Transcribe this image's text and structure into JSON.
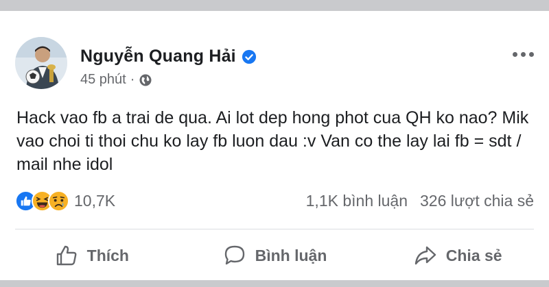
{
  "post": {
    "author": "Nguyễn Quang Hải",
    "time": "45 phút",
    "meta_separator": "·",
    "text": "Hack vao fb a trai de qua. Ai lot dep hong phot cua QH ko nao? Mik vao choi ti thoi chu ko lay fb luon dau :v Van co the lay lai fb = sdt / mail nhe idol",
    "reactions_count": "10,7K",
    "comments_count": "1,1K bình luận",
    "shares_count": "326 lượt chia sẻ"
  },
  "actions": {
    "like_label": "Thích",
    "comment_label": "Bình luận",
    "share_label": "Chia sẻ"
  },
  "icons": {
    "verified": "verified-badge-icon",
    "privacy": "globe-icon",
    "menu": "more-horizontal-icon",
    "reactions": [
      "like-reaction-icon",
      "haha-reaction-icon",
      "sad-reaction-icon"
    ],
    "like": "thumbs-up-icon",
    "comment": "speech-bubble-icon",
    "share": "share-arrow-icon"
  },
  "colors": {
    "verified_blue": "#1877f2",
    "secondary_text": "#65676b",
    "primary_text": "#1c1e21",
    "reaction_yellow": "#f7b125"
  }
}
